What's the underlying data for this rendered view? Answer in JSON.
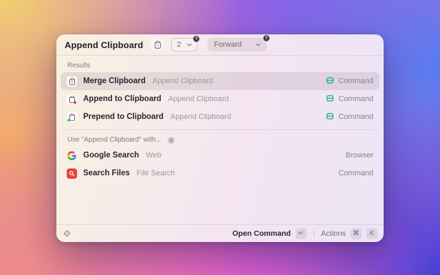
{
  "header": {
    "title": "Append Clipboard",
    "argument_dropdown": {
      "value": "2",
      "hint_badge": "?"
    },
    "direction_dropdown": {
      "value": "Forward",
      "hint_badge": "?"
    }
  },
  "results": {
    "section_label": "Results",
    "items": [
      {
        "title": "Merge Clipboard",
        "subtitle": "Append Clipboard",
        "type": "Command"
      },
      {
        "title": "Append to Clipboard",
        "subtitle": "Append Clipboard",
        "type": "Command"
      },
      {
        "title": "Prepend to Clipboard",
        "subtitle": "Append Clipboard",
        "type": "Command"
      }
    ]
  },
  "suggestions": {
    "section_label": "Use \"Append Clipboard\" with...",
    "items": [
      {
        "title": "Google Search",
        "subtitle": "Web",
        "type": "Browser"
      },
      {
        "title": "Search Files",
        "subtitle": "File Search",
        "type": "Command"
      }
    ]
  },
  "footer": {
    "open_command_label": "Open Command",
    "open_command_key": "↵",
    "actions_label": "Actions",
    "actions_keys": [
      "⌘",
      "K"
    ]
  },
  "colors": {
    "command_icon_green": "#0eb87b",
    "search_files_red": "#e8413c",
    "accent_red_dot": "#e8413c",
    "accent_teal_dot": "#2bbfa4"
  }
}
